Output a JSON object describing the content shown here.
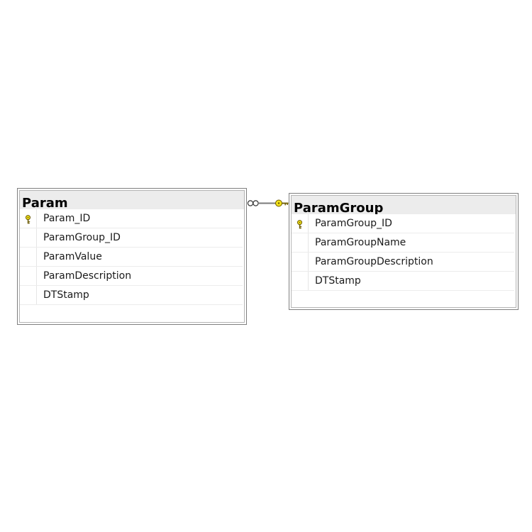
{
  "tables": [
    {
      "title": "Param",
      "columns": [
        {
          "name": "Param_ID",
          "primary_key": true,
          "key_icon": "key-icon"
        },
        {
          "name": "ParamGroup_ID",
          "primary_key": false
        },
        {
          "name": "ParamValue",
          "primary_key": false
        },
        {
          "name": "ParamDescription",
          "primary_key": false
        },
        {
          "name": "DTStamp",
          "primary_key": false
        }
      ]
    },
    {
      "title": "ParamGroup",
      "columns": [
        {
          "name": "ParamGroup_ID",
          "primary_key": true,
          "key_icon": "key-icon"
        },
        {
          "name": "ParamGroupName",
          "primary_key": false
        },
        {
          "name": "ParamGroupDescription",
          "primary_key": false
        },
        {
          "name": "DTStamp",
          "primary_key": false
        }
      ]
    }
  ],
  "relationship": {
    "from_table": "Param",
    "to_table": "ParamGroup",
    "from_end": "many (infinity-icon)",
    "to_end": "one (key-icon)"
  },
  "colors": {
    "title_bar": "#ececec",
    "border": "#7f7f7f",
    "key_fill": "#f2e21a",
    "connector": "#7a7a7a"
  }
}
